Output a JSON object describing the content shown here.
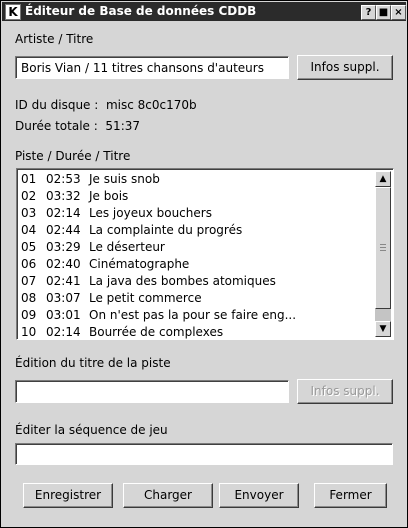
{
  "window": {
    "app_icon": "K",
    "title": "Éditeur de Base de données CDDB",
    "buttons": [
      "?",
      "■",
      "×"
    ]
  },
  "artist_title": {
    "label": "Artiste / Titre",
    "value": "Boris Vian / 11 titres chansons d'auteurs",
    "info_button": "Infos suppl."
  },
  "disc": {
    "id_label": "ID du disque :",
    "id_value": "misc  8c0c170b",
    "duration_label": "Durée totale :",
    "duration_value": "51:37"
  },
  "tracks": {
    "header": "Piste / Durée / Titre",
    "items": [
      {
        "num": "01",
        "dur": "02:53",
        "title": "Je suis snob"
      },
      {
        "num": "02",
        "dur": "03:32",
        "title": "Je bois"
      },
      {
        "num": "03",
        "dur": "02:14",
        "title": "Les joyeux bouchers"
      },
      {
        "num": "04",
        "dur": "02:44",
        "title": "La complainte du progrés"
      },
      {
        "num": "05",
        "dur": "03:29",
        "title": "Le déserteur"
      },
      {
        "num": "06",
        "dur": "02:40",
        "title": "Cinématographe"
      },
      {
        "num": "07",
        "dur": "02:41",
        "title": "La java des bombes atomiques"
      },
      {
        "num": "08",
        "dur": "03:07",
        "title": "Le petit commerce"
      },
      {
        "num": "09",
        "dur": "03:01",
        "title": "On n'est pas la pour se faire eng..."
      },
      {
        "num": "10",
        "dur": "02:14",
        "title": "Bourrée de complexes"
      }
    ]
  },
  "track_edit": {
    "label": "Édition du titre de la piste",
    "value": "",
    "info_button": "Infos suppl."
  },
  "sequence": {
    "label": "Éditer la séquence de jeu",
    "value": ""
  },
  "footer": {
    "save": "Enregistrer",
    "load": "Charger",
    "send": "Envoyer",
    "close": "Fermer"
  }
}
